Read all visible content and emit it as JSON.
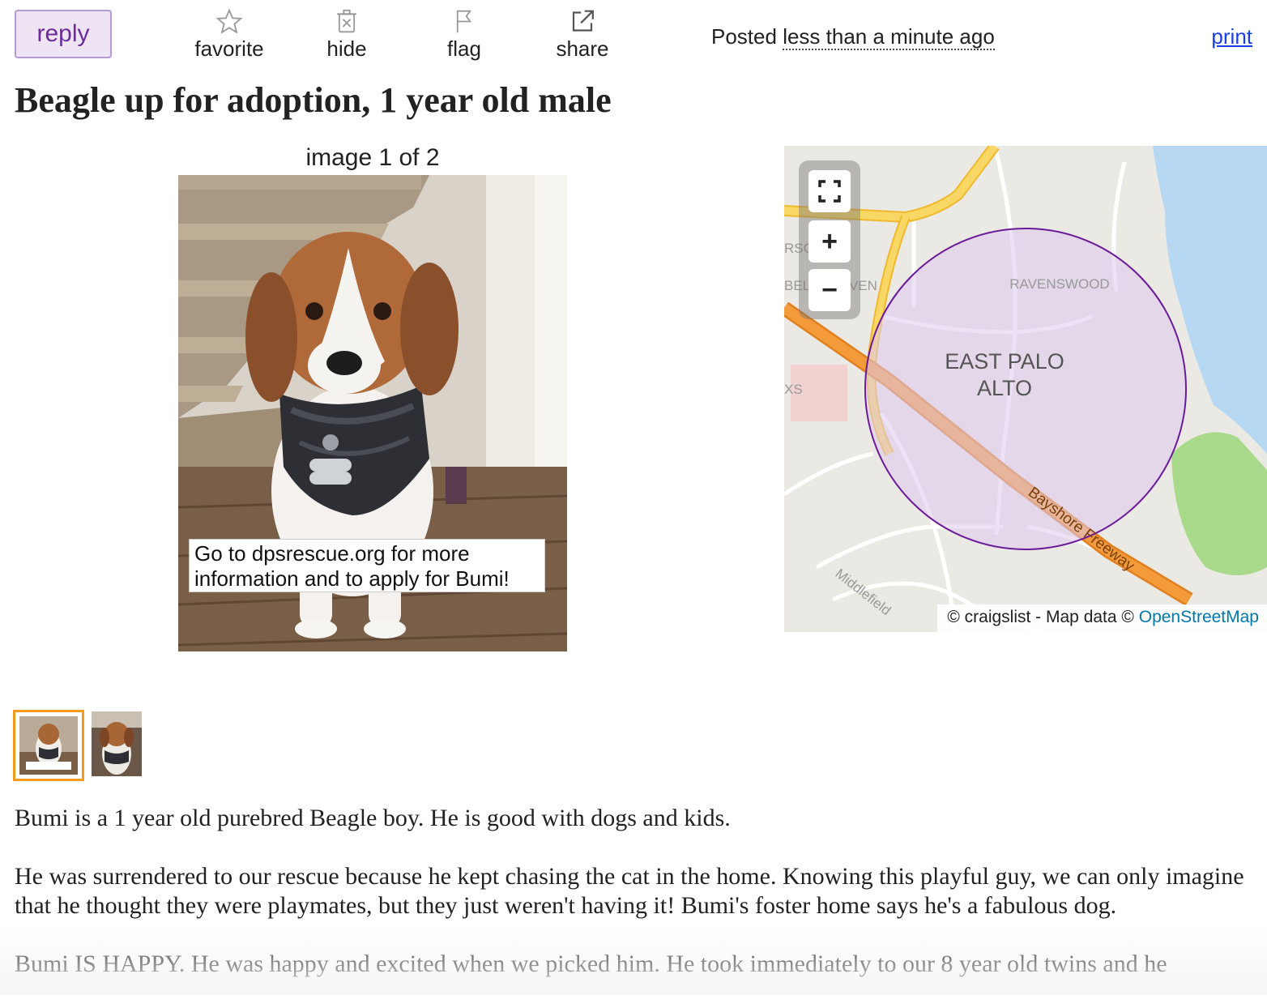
{
  "toolbar": {
    "reply_label": "reply",
    "favorite_label": "favorite",
    "hide_label": "hide",
    "flag_label": "flag",
    "share_label": "share",
    "posted_prefix": "Posted",
    "posted_time": "less than a minute ago",
    "print_label": "print"
  },
  "posting": {
    "title": "Beagle up for adoption, 1 year old male",
    "paragraphs": [
      "Bumi is a 1 year old purebred Beagle boy. He is good with dogs and kids.",
      "He was surrendered to our rescue because he kept chasing the cat in the home. Knowing this playful guy, we can only imagine that he thought they were playmates, but they just weren't having it! Bumi's foster home says he's a fabulous dog.",
      "Bumi IS HAPPY. He was happy and excited when we picked him. He took immediately to our 8 year old twins and he"
    ]
  },
  "gallery": {
    "counter": "image 1 of 2",
    "photo_caption": "Go to dpsrescue.org for more information and to apply for Bumi!",
    "thumbnails": [
      "photo-1",
      "photo-2"
    ]
  },
  "map": {
    "labels": {
      "city_line1": "EAST PALO",
      "city_line2": "ALTO",
      "ravenswood": "RAVENSWOOD",
      "belle_haven": "BELLE HAVEN",
      "freeway": "Bayshore Freeway",
      "middlefield": "Middlefield",
      "frag_rsc": "RSC",
      "frag_xs": "XS"
    },
    "attribution_prefix": "© craigslist - Map data ©",
    "attribution_link": "OpenStreetMap",
    "controls": {
      "fullscreen_icon": "fullscreen-icon",
      "zoom_in": "+",
      "zoom_out": "−"
    },
    "colors": {
      "radius_fill": "#dcc8ec",
      "radius_stroke": "#6a1b9a",
      "freeway": "#f39b3a",
      "highway": "#f7c948",
      "water": "#b6d8f2",
      "park": "#a9d98a"
    }
  },
  "colors": {
    "reply_bg": "#eee4f3",
    "reply_text": "#6b2c9c",
    "link": "#1a3ee8",
    "thumb_highlight": "#f39a1f"
  }
}
